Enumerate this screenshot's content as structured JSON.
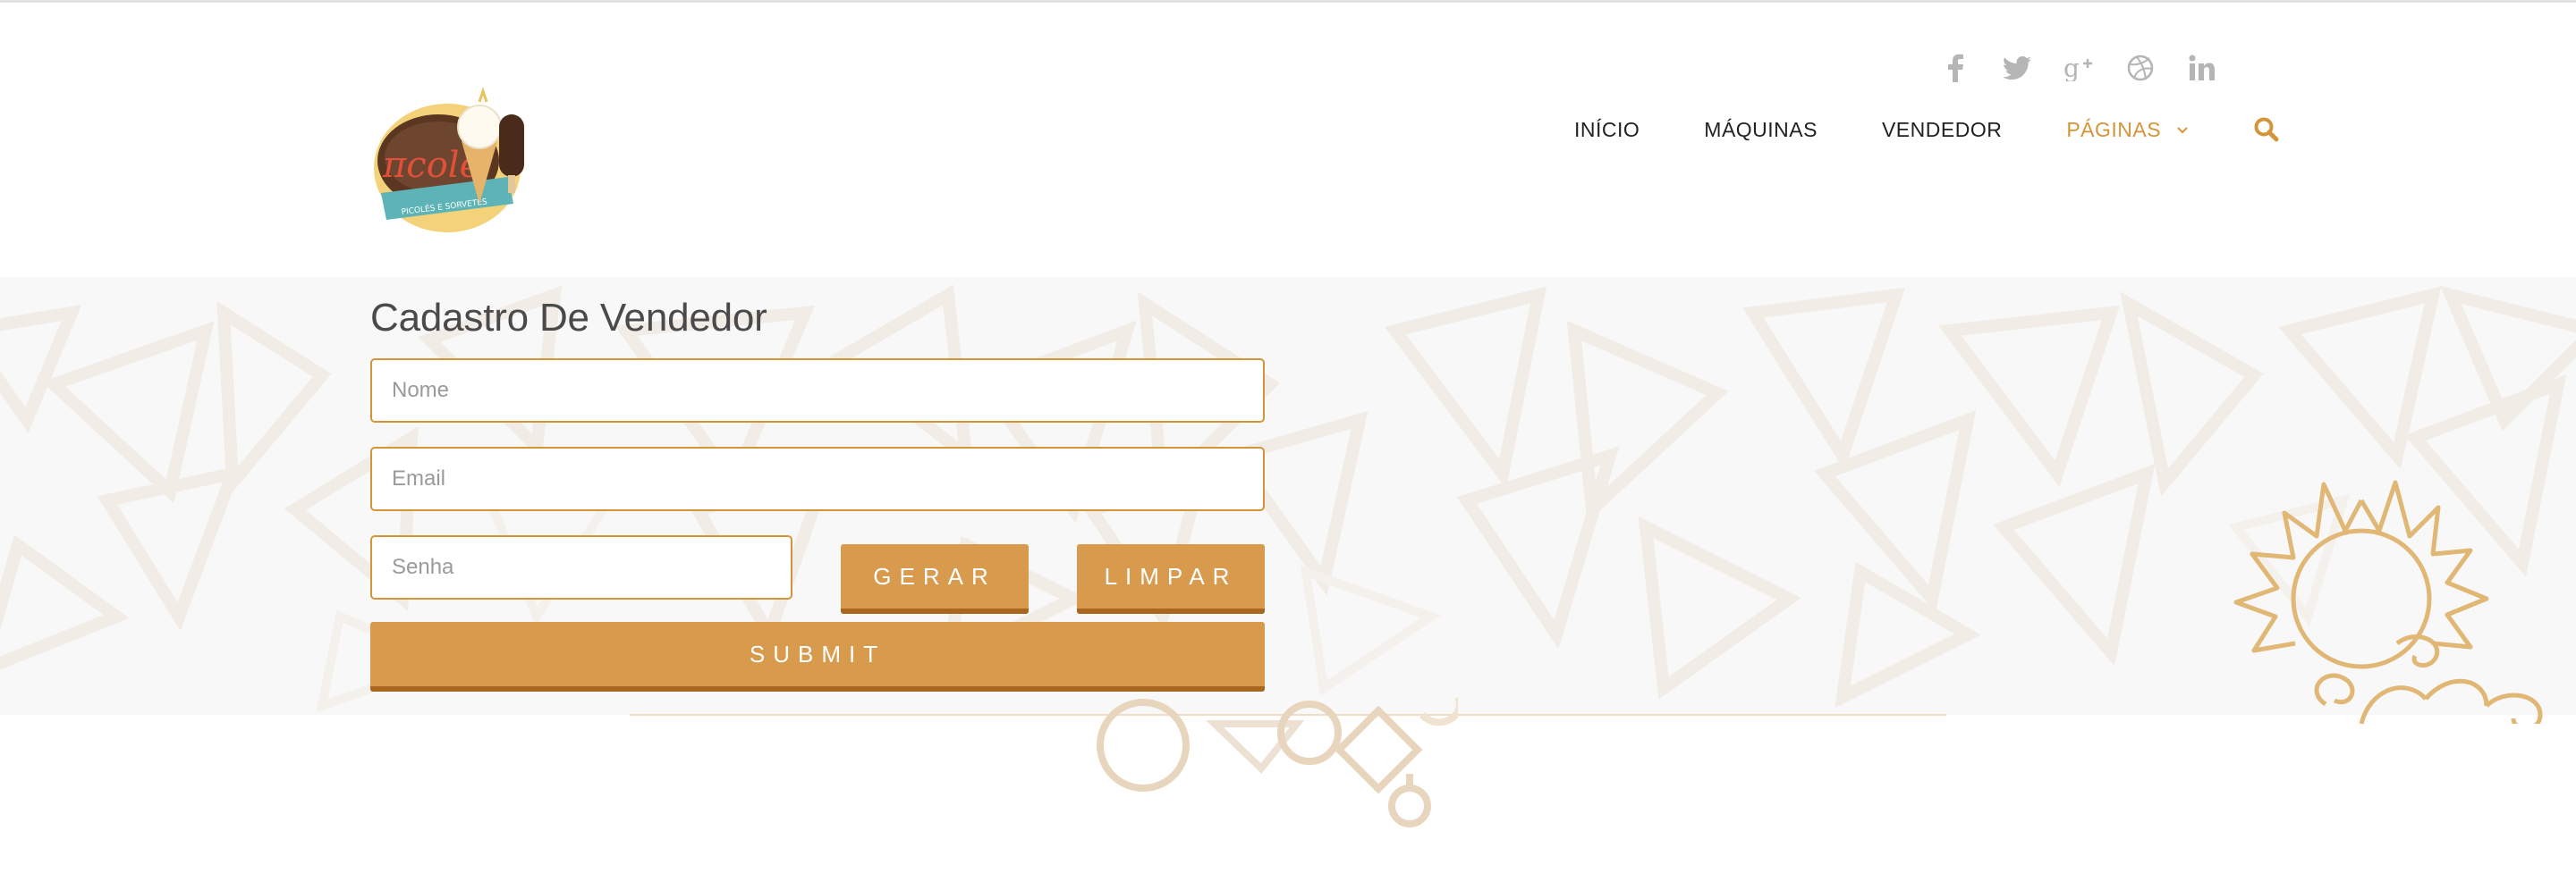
{
  "header": {
    "logo_text": "πcolé",
    "logo_tagline": "PICOLÉS E SORVETES",
    "social": [
      {
        "icon": "facebook-icon"
      },
      {
        "icon": "twitter-icon"
      },
      {
        "icon": "google-plus-icon"
      },
      {
        "icon": "dribbble-icon"
      },
      {
        "icon": "linkedin-icon"
      }
    ],
    "nav": [
      {
        "label": "INÍCIO"
      },
      {
        "label": "MÁQUINAS"
      },
      {
        "label": "VENDEDOR"
      },
      {
        "label": "PÁGINAS",
        "active": true,
        "has_dropdown": true
      }
    ],
    "search_icon": "search-icon"
  },
  "form": {
    "title": "Cadastro De Vendedor",
    "nome_placeholder": "Nome",
    "email_placeholder": "Email",
    "senha_placeholder": "Senha",
    "gerar_label": "GERAR",
    "limpar_label": "LIMPAR",
    "submit_label": "SUBMIT"
  },
  "colors": {
    "accent": "#d4953a",
    "button": "#d89a4c",
    "button_shadow": "#a9661e",
    "band_bg": "#f9f8f8"
  }
}
